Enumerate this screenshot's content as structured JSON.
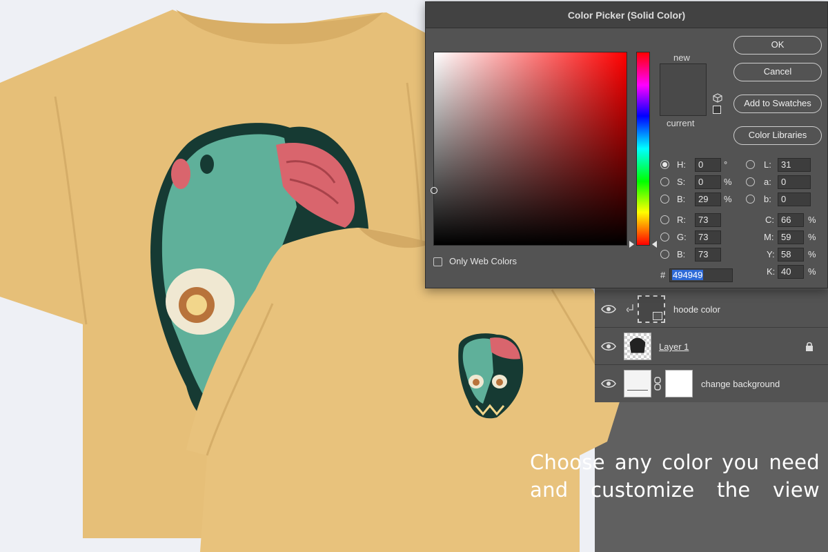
{
  "dialog": {
    "title": "Color Picker (Solid Color)",
    "new_label": "new",
    "current_label": "current",
    "swatch_color": "#494949",
    "buttons": {
      "ok": "OK",
      "cancel": "Cancel",
      "add_to_swatches": "Add to Swatches",
      "color_libraries": "Color Libraries"
    },
    "hsb": [
      {
        "label": "H:",
        "value": "0",
        "unit": "°",
        "selected": true
      },
      {
        "label": "S:",
        "value": "0",
        "unit": "%",
        "selected": false
      },
      {
        "label": "B:",
        "value": "29",
        "unit": "%",
        "selected": false
      }
    ],
    "rgb": [
      {
        "label": "R:",
        "value": "73"
      },
      {
        "label": "G:",
        "value": "73"
      },
      {
        "label": "B:",
        "value": "73"
      }
    ],
    "lab": [
      {
        "label": "L:",
        "value": "31"
      },
      {
        "label": "a:",
        "value": "0"
      },
      {
        "label": "b:",
        "value": "0"
      }
    ],
    "cmyk": [
      {
        "label": "C:",
        "value": "66",
        "unit": "%"
      },
      {
        "label": "M:",
        "value": "59",
        "unit": "%"
      },
      {
        "label": "Y:",
        "value": "58",
        "unit": "%"
      },
      {
        "label": "K:",
        "value": "40",
        "unit": "%"
      }
    ],
    "hex_prefix": "#",
    "hex_value": "494949",
    "only_web_colors": "Only Web Colors"
  },
  "layers": [
    {
      "name": "hoode color"
    },
    {
      "name": "Layer 1"
    },
    {
      "name": "change background"
    }
  ],
  "tagline": {
    "line1": "Choose any color you need",
    "line2": "and customize the view"
  },
  "colors": {
    "shirt": "#e9c27a",
    "zombie_skin": "#5fb09a",
    "brain": "#d9656d",
    "outline": "#163a33"
  }
}
